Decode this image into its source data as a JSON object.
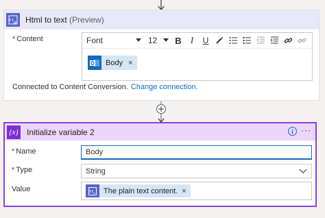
{
  "card1": {
    "title": "Html to text",
    "title_suffix": "(Preview)",
    "content_label": "Content",
    "required_mark": "*",
    "toolbar": {
      "font": "Font",
      "size": "12",
      "bold": "B",
      "italic": "I",
      "underline": "U"
    },
    "token": {
      "label": "Body",
      "remove": "×"
    },
    "connected_text": "Connected to Content Conversion.",
    "change_connection": "Change connection."
  },
  "card2": {
    "title": "Initialize variable 2",
    "variable_icon": "{x}",
    "info_icon": "i",
    "more_icon": "···",
    "required_mark": "*",
    "name_label": "Name",
    "name_value": "Body",
    "type_label": "Type",
    "type_value": "String",
    "value_label": "Value",
    "value_token": {
      "label": "The plain text content.",
      "remove": "×"
    }
  },
  "icons": {
    "flow_arrow": "arrow-down-icon",
    "add_step": "plus-icon",
    "html_to_text": "html-to-text-icon",
    "outlook": "outlook-icon",
    "variable": "variable-icon"
  },
  "colors": {
    "card1_header": "#e7e9f8",
    "card2_header": "#ebd6fb",
    "card2_border": "#8b3fdc",
    "token_bg": "#d4e6f6",
    "link": "#0f6cbd",
    "required": "#a4262c"
  }
}
